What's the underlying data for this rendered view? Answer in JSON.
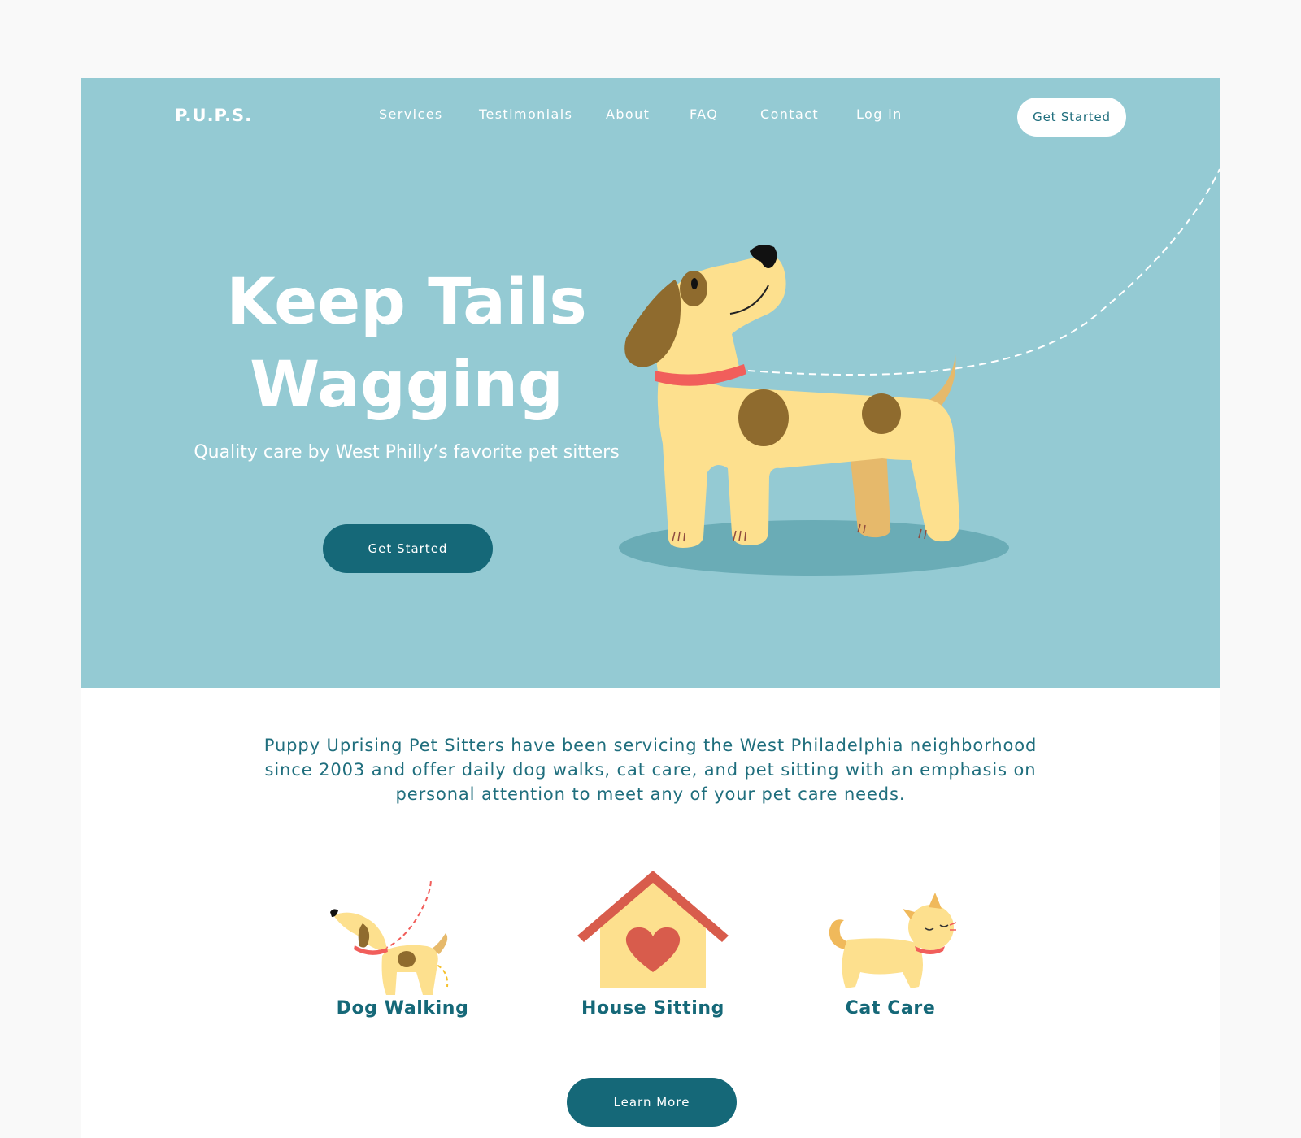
{
  "header": {
    "logo": "P.U.P.S.",
    "nav": [
      {
        "label": "Services"
      },
      {
        "label": "Testimonials"
      },
      {
        "label": "About"
      },
      {
        "label": "FAQ"
      },
      {
        "label": "Contact"
      },
      {
        "label": "Log in"
      }
    ],
    "cta_label": "Get Started"
  },
  "hero": {
    "title_line1": "Keep Tails",
    "title_line2": "Wagging",
    "subtitle": "Quality care by West Philly’s favorite pet sitters",
    "cta_label": "Get Started",
    "illustration": "dog-icon"
  },
  "intro": {
    "text": "Puppy Uprising Pet Sitters have been servicing the West Philadelphia neighborhood since 2003 and offer daily dog walks, cat care, and pet sitting with an emphasis on personal attention to meet any of your pet care needs."
  },
  "services": [
    {
      "label": "Dog Walking",
      "icon": "dog-walking-icon"
    },
    {
      "label": "House Sitting",
      "icon": "house-heart-icon"
    },
    {
      "label": "Cat Care",
      "icon": "cat-icon"
    }
  ],
  "learn_more_label": "Learn More",
  "colors": {
    "hero_bg": "#94cad3",
    "primary": "#156878",
    "text_teal": "#1f6e7d",
    "dog_body": "#fde08e",
    "dog_spot": "#8f6b2e",
    "collar": "#f15e5b",
    "house_roof": "#d85c4c",
    "page_bg": "#f9f9f9"
  }
}
